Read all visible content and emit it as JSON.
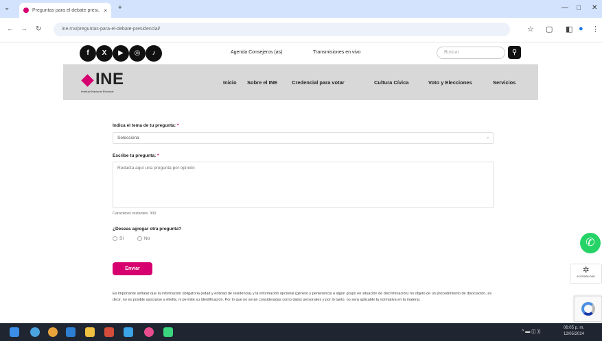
{
  "browser": {
    "tab_title": "Preguntas para el debate presi...",
    "tab_close": "×",
    "new_tab": "+",
    "url": "ine.mx/preguntas-para-el-debate-presidencial/",
    "nav_back": "←",
    "nav_forward": "→",
    "nav_reload": "↻",
    "window_controls": [
      "—",
      "□",
      "✕"
    ]
  },
  "topbar": {
    "social_icons": [
      "facebook-icon",
      "x-icon",
      "youtube-icon",
      "instagram-icon",
      "tiktok-icon"
    ],
    "link_agenda": "Agenda Consejeros (as)",
    "link_live": "Transmisiones en vivo",
    "search_placeholder": "Buscar"
  },
  "header": {
    "logo_text": "INE",
    "logo_sub": "Instituto Nacional Electoral",
    "nav": [
      "Inicio",
      "Sobre el INE",
      "Credencial para votar",
      "Cultura Cívica",
      "Voto y Elecciones",
      "Servicios"
    ]
  },
  "form": {
    "topic_label": "Indica el tema de tu pregunta:",
    "topic_required": "*",
    "topic_value": "Selecciona",
    "question_label": "Escribe tu pregunta:",
    "question_required": "*",
    "question_placeholder": "Redacta aquí una pregunta por opinión",
    "char_count": "Caracteres restantes: 300",
    "another_label": "¿Deseas agregar otra pregunta?",
    "option_yes": "Sí",
    "option_no": "No",
    "send_button": "Enviar",
    "notice": "Es importante señalar que la información obligatoria (edad y entidad de residencia) y la información opcional (género y pertenencia a algún grupo en situación de discriminación) no objeto de un procedimiento de disociación, es decir, no es posible asociarse a él/ella, ni permite su identificación. Por lo que no serán consideradas como datos personales y por lo tanto, no será aplicable la normativa en la materia."
  },
  "floating": {
    "whatsapp": "✆",
    "accessibility_label": "ACCESIBILIDAD"
  },
  "taskbar": {
    "clock_time": "06:05 p. m.",
    "clock_date": "12/05/2024",
    "tray": "^ ▬ ◫ ))"
  },
  "colors": {
    "brand_magenta": "#d6006f",
    "header_gray": "#d8d8d8",
    "taskbar": "#1f2632"
  }
}
